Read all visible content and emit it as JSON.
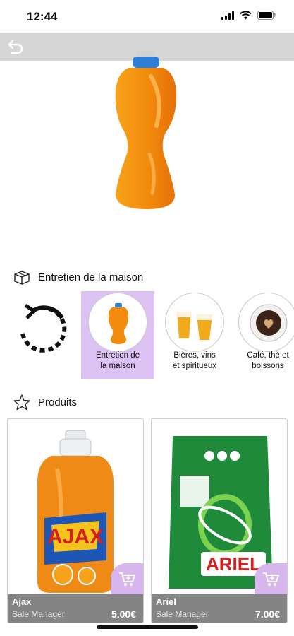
{
  "status_bar": {
    "time": "12:44",
    "icons": [
      "signal-icon",
      "wifi-icon",
      "battery-icon"
    ]
  },
  "top_bar": {
    "back_icon": "back-arrow-icon",
    "bg_color": "#d6d6d6"
  },
  "hero": {
    "image": "orange-detergent-bottle"
  },
  "category_section": {
    "title": "Entretien de la maison",
    "icon": "box-icon",
    "refresh_icon": "refresh-icon",
    "items": [
      {
        "label_line1": "Entretien de",
        "label_line2": "la maison",
        "icon": "detergent-bottle",
        "selected": true
      },
      {
        "label_line1": "Bières, vins",
        "label_line2": "et spiritueux",
        "icon": "beer-glasses",
        "selected": false
      },
      {
        "label_line1": "Café, thé et",
        "label_line2": "boissons",
        "icon": "coffee-cup",
        "selected": false
      }
    ],
    "selected_color": "#dcc1f3"
  },
  "products_section": {
    "title": "Produits",
    "icon": "star-icon",
    "items": [
      {
        "name": "Ajax",
        "subtitle": "Sale Manager",
        "price": "5.00€",
        "image": "ajax-bottle",
        "cart_icon": "add-to-cart-icon"
      },
      {
        "name": "Ariel",
        "subtitle": "Sale Manager",
        "price": "7.00€",
        "image": "ariel-pack",
        "cart_icon": "add-to-cart-icon"
      }
    ],
    "accent_color": "#d7b6ee"
  }
}
